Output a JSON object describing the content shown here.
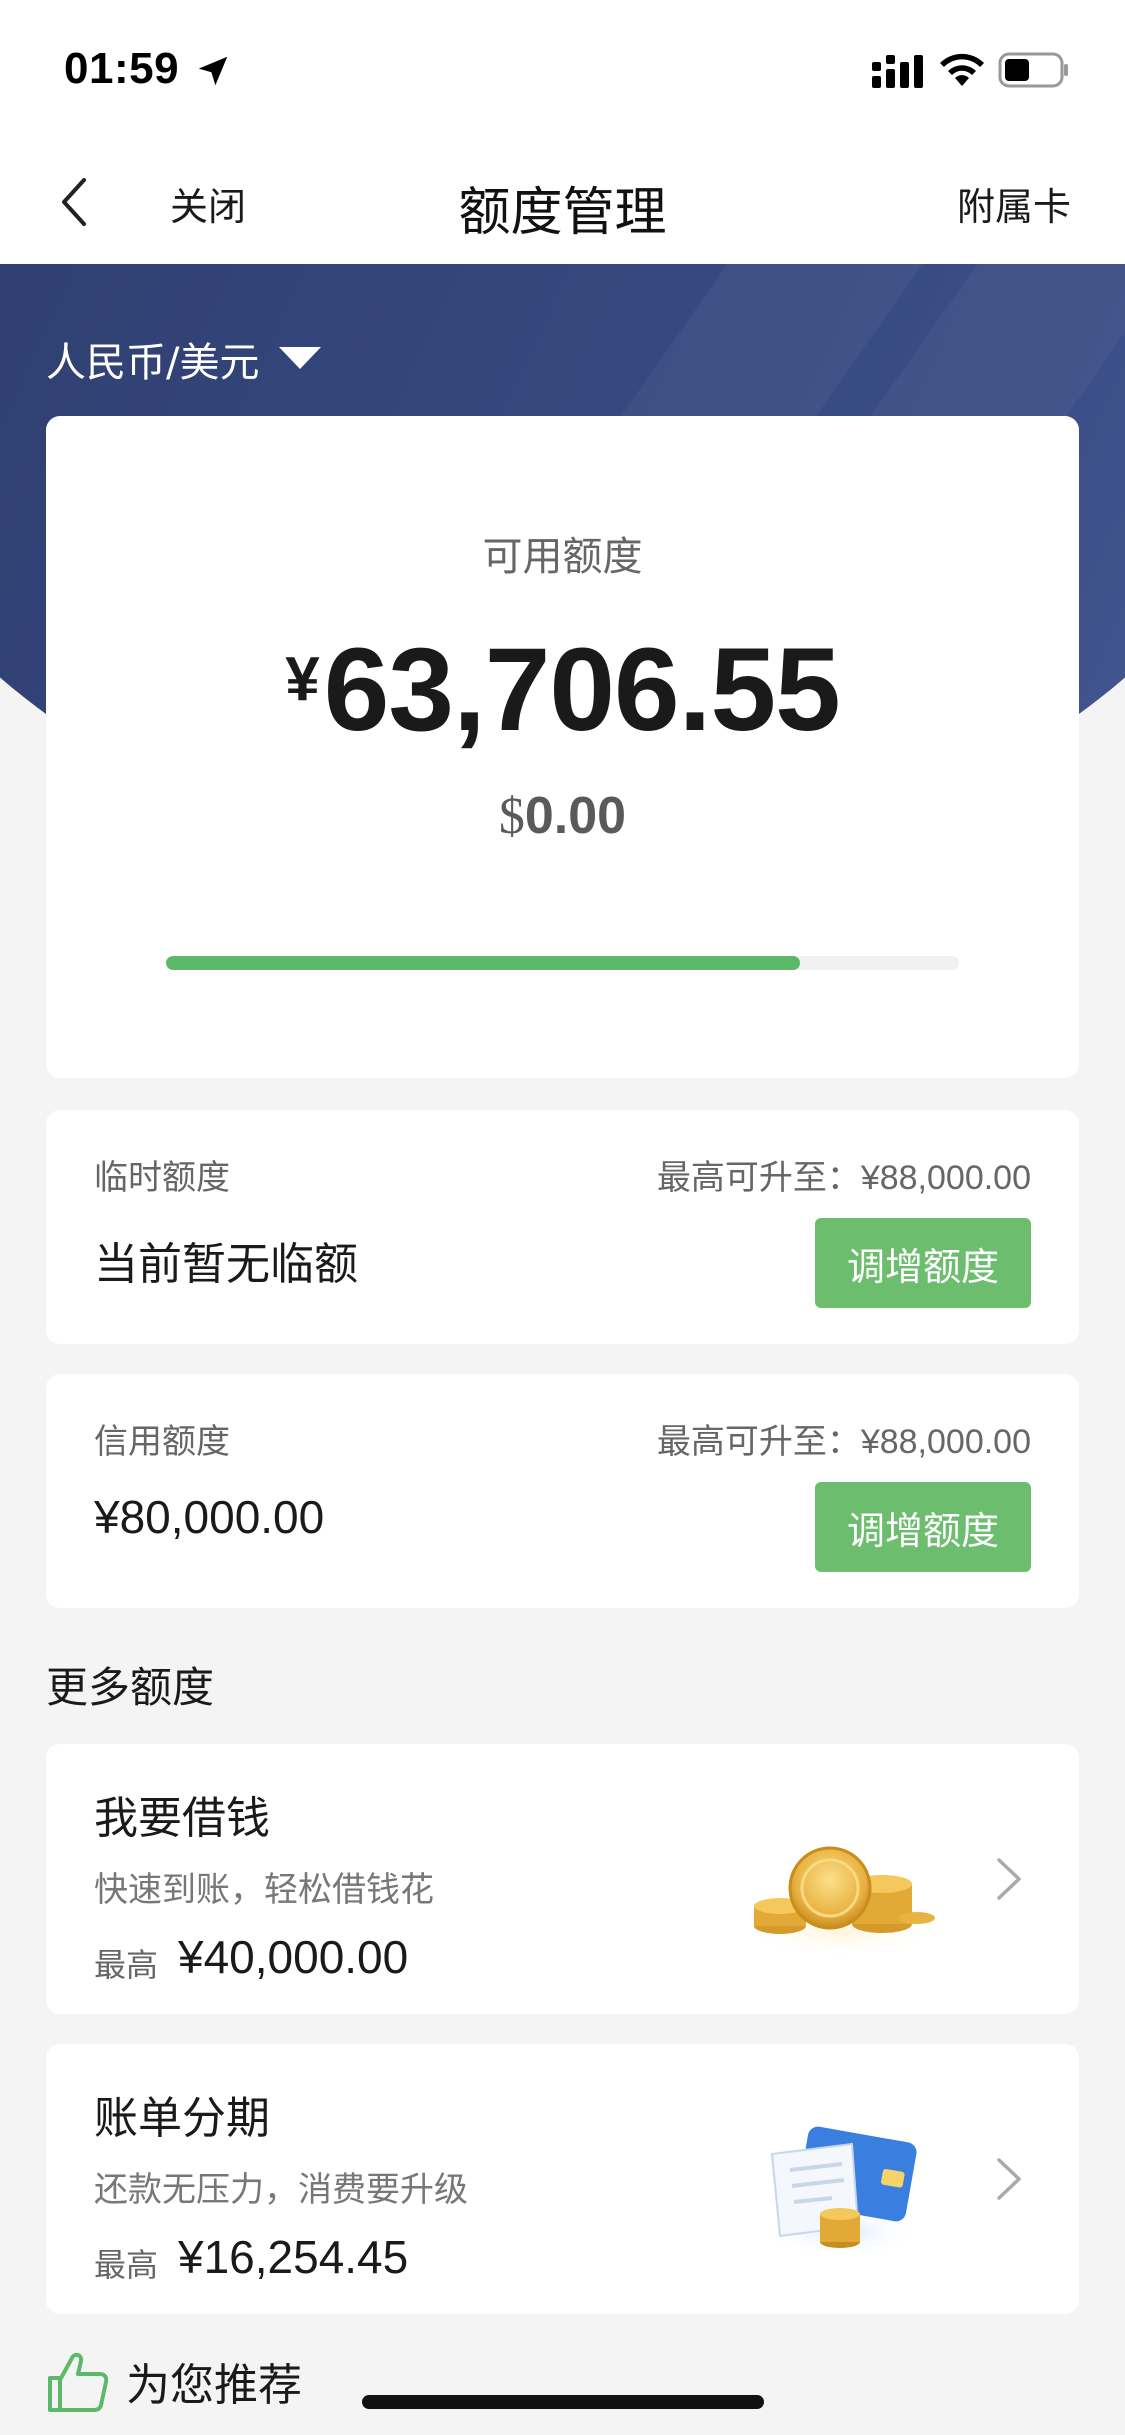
{
  "status_bar": {
    "time": "01:59",
    "icons": [
      "location-arrow-icon",
      "cellular-signal-icon",
      "wifi-icon",
      "battery-icon"
    ]
  },
  "nav": {
    "back_icon": "chevron-left-icon",
    "close_label": "关闭",
    "title": "额度管理",
    "right_label": "附属卡"
  },
  "hero": {
    "currency_selector": "人民币/美元",
    "caret_icon": "caret-down-icon",
    "color": "#33447a"
  },
  "balance": {
    "available_label": "可用额度",
    "available_symbol": "¥",
    "available_value": "63,706.55",
    "usd_symbol": "$",
    "usd_value": "0.00",
    "usage_fraction": 0.8,
    "bar_color": "#5cb96a"
  },
  "temp_limit": {
    "label": "临时额度",
    "max_label": "最高可升至：¥88,000.00",
    "value": "当前暂无临额",
    "button": "调增额度"
  },
  "credit_limit": {
    "label": "信用额度",
    "max_label": "最高可升至：¥88,000.00",
    "value": "¥80,000.00",
    "button": "调增额度"
  },
  "more": {
    "section_title": "更多额度",
    "items": [
      {
        "title": "我要借钱",
        "desc": "快速到账，轻松借钱花",
        "max_label": "最高",
        "max_value": "¥40,000.00",
        "image_icon": "gold-coins-icon"
      },
      {
        "title": "账单分期",
        "desc": "还款无压力，消费要升级",
        "max_label": "最高",
        "max_value": "¥16,254.45",
        "image_icon": "bill-card-coins-icon"
      }
    ]
  },
  "recommend": {
    "icon": "thumbs-up-icon",
    "label": "为您推荐"
  },
  "colors": {
    "accent_green": "#6cbd6e",
    "background": "#f4f4f4"
  }
}
